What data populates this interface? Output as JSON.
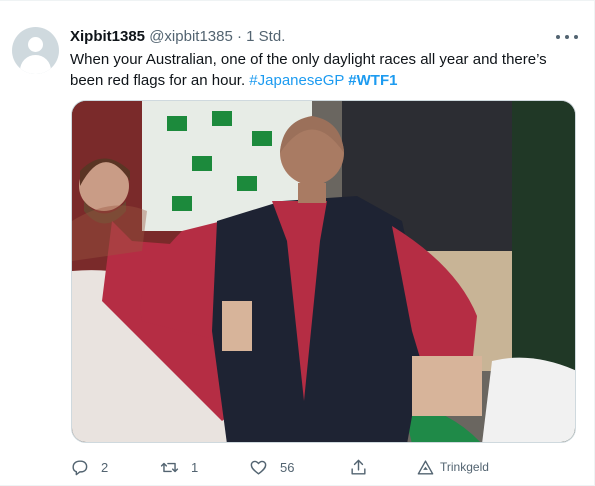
{
  "tweet": {
    "author_name": "Xipbit1385",
    "handle": "@xipbit1385",
    "separator": "·",
    "time": "1 Std.",
    "text_plain": "When your Australian, one of the only daylight races all year and there’s been red flags for an hour.",
    "hashtags": [
      "#JapaneseGP",
      "#WTF1"
    ],
    "media_alt": "photo",
    "colors": {
      "accent": "#1d9bf0",
      "muted": "#536471",
      "text": "#0f1419"
    }
  },
  "actions": {
    "reply_count": "2",
    "retweet_count": "1",
    "like_count": "56",
    "tip_label": "Trinkgeld"
  },
  "icons": [
    "more-icon",
    "reply-icon",
    "retweet-icon",
    "like-icon",
    "share-icon",
    "tip-icon"
  ]
}
